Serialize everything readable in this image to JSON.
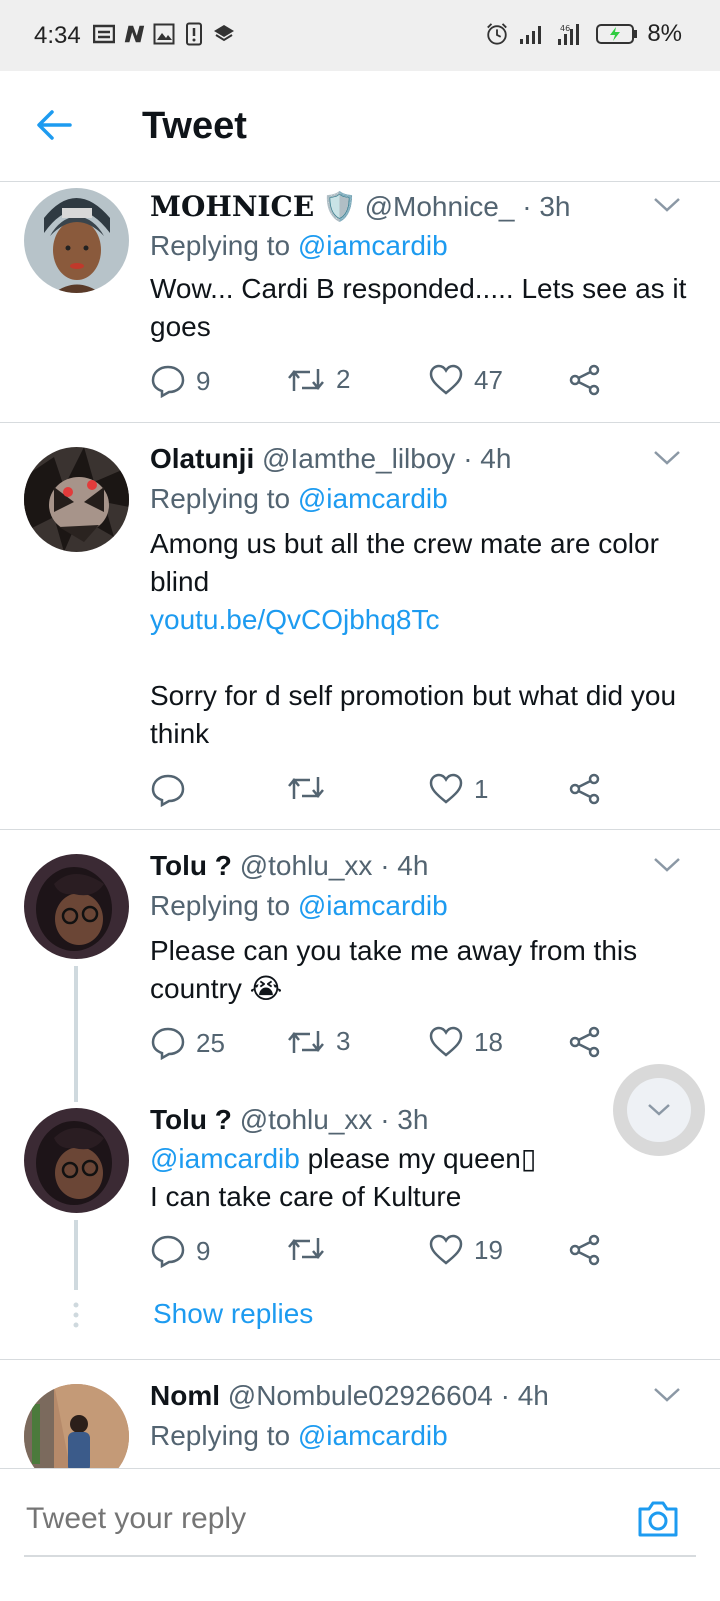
{
  "status_bar": {
    "time": "4:34",
    "battery": "8%",
    "left_icons": [
      "notes-icon",
      "n-icon",
      "image-icon",
      "alert-icon",
      "layers-icon"
    ],
    "right_icons": [
      "alarm-icon",
      "signal-icon",
      "signal-icon",
      "battery-icon"
    ]
  },
  "header": {
    "title": "Tweet",
    "back_icon": "arrow-left-icon"
  },
  "tweets": [
    {
      "name": "MOHNICE",
      "badge": "🛡️",
      "handle": "@Mohnice_",
      "time": "· 3h",
      "replying_prefix": "Replying to",
      "replying_to": "@iamcardib",
      "text": "Wow... Cardi B responded..... Lets see as it goes",
      "replies": "9",
      "retweets": "2",
      "likes": "47"
    },
    {
      "name": "Olatunji",
      "handle": "@Iamthe_lilboy",
      "time": "· 4h",
      "replying_prefix": "Replying to",
      "replying_to": "@iamcardib",
      "text_line1": "Among us but all the crew mate are color blind",
      "link": "youtu.be/QvCOjbhq8Tc",
      "text_line2": "Sorry for d self promotion but what did you think",
      "replies": "",
      "retweets": "",
      "likes": "1"
    },
    {
      "name": "Tolu ?",
      "handle": "@tohlu_xx",
      "time": "· 4h",
      "replying_prefix": "Replying to",
      "replying_to": "@iamcardib",
      "text": "Please can you take me away from this country 😭",
      "replies": "25",
      "retweets": "3",
      "likes": "18"
    },
    {
      "name": "Tolu ?",
      "handle": "@tohlu_xx",
      "time": "· 3h",
      "mention": "@iamcardib",
      "text_rest": " please my queen▯",
      "text_line2": "I can take care of Kulture",
      "replies": "9",
      "retweets": "",
      "likes": "19"
    },
    {
      "name": "Noml",
      "handle": "@Nombule02926604",
      "time": "· 4h",
      "replying_prefix": "Replying to",
      "replying_to": "@iamcardib"
    }
  ],
  "show_replies": "Show replies",
  "reply_bar": {
    "placeholder": "Tweet your reply",
    "camera_icon": "camera-icon"
  },
  "colors": {
    "accent": "#1d9bf0",
    "text": "#0f1419",
    "muted": "#536471",
    "status_bg": "#efefef"
  }
}
